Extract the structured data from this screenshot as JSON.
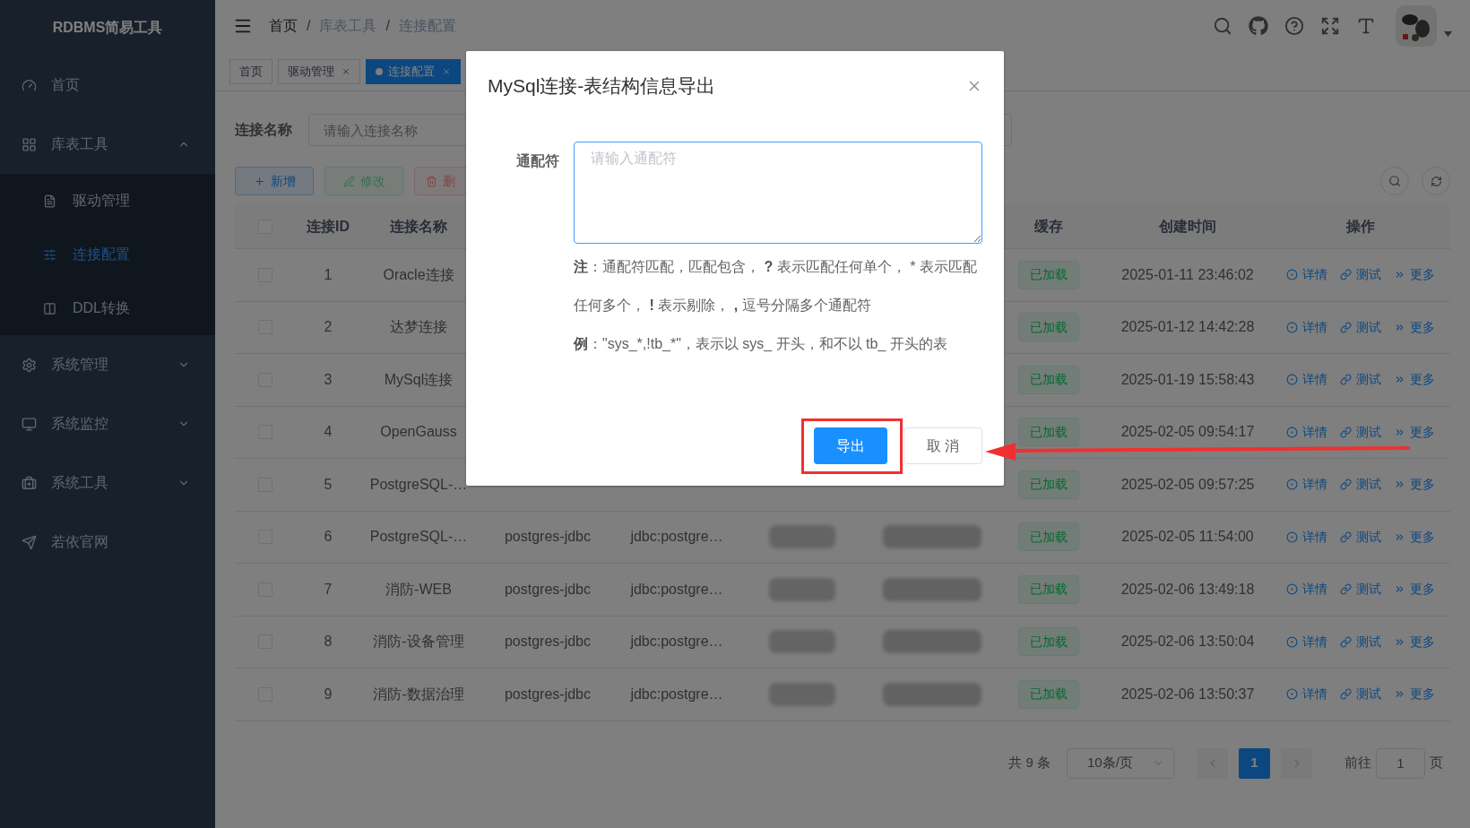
{
  "sidebar": {
    "title": "RDBMS简易工具",
    "items": [
      {
        "label": "首页"
      },
      {
        "label": "库表工具",
        "expanded": true,
        "children": [
          {
            "label": "驱动管理",
            "selected": false
          },
          {
            "label": "连接配置",
            "selected": true
          },
          {
            "label": "DDL转换",
            "selected": false
          }
        ]
      },
      {
        "label": "系统管理",
        "expanded": false
      },
      {
        "label": "系统监控",
        "expanded": false
      },
      {
        "label": "系统工具",
        "expanded": false
      },
      {
        "label": "若依官网"
      }
    ]
  },
  "breadcrumb": [
    "首页",
    "库表工具",
    "连接配置"
  ],
  "breadcrumb_separator": "/",
  "tabs": [
    {
      "label": "首页",
      "closable": false,
      "selected": false
    },
    {
      "label": "驱动管理",
      "closable": true,
      "selected": false
    },
    {
      "label": "连接配置",
      "closable": true,
      "selected": true
    }
  ],
  "search": {
    "label": "连接名称",
    "placeholder": "请输入连接名称"
  },
  "toolbar": [
    {
      "label": "新增",
      "kind": "primary"
    },
    {
      "label": "修改",
      "kind": "success"
    },
    {
      "label": "删",
      "kind": "danger"
    }
  ],
  "table": {
    "select_all_checked": false,
    "columns": {
      "id": "连接ID",
      "name": "连接名称",
      "cache": "缓存",
      "created": "创建时间",
      "actions": "操作"
    },
    "rows": [
      {
        "checked": false,
        "id": "1",
        "name": "Oracle连接",
        "cache": "已加载",
        "created": "2025-01-11 23:46:02",
        "actions": [
          "详情",
          "测试",
          "更多"
        ]
      },
      {
        "checked": false,
        "id": "2",
        "name": "达梦连接",
        "cache": "已加载",
        "created": "2025-01-12 14:42:28",
        "actions": [
          "详情",
          "测试",
          "更多"
        ]
      },
      {
        "checked": false,
        "id": "3",
        "name": "MySql连接",
        "cache": "已加载",
        "created": "2025-01-19 15:58:43",
        "actions": [
          "详情",
          "测试",
          "更多"
        ]
      },
      {
        "checked": false,
        "id": "4",
        "name": "OpenGauss",
        "cache": "已加载",
        "created": "2025-02-05 09:54:17",
        "actions": [
          "详情",
          "测试",
          "更多"
        ]
      },
      {
        "checked": false,
        "id": "5",
        "name": "PostgreSQL-…",
        "cache": "已加载",
        "created": "2025-02-05 09:57:25",
        "actions": [
          "详情",
          "测试",
          "更多"
        ]
      },
      {
        "checked": false,
        "id": "6",
        "name": "PostgreSQL-…",
        "driver": "postgres-jdbc",
        "url": "jdbc:postgre…",
        "cache": "已加载",
        "created": "2025-02-05 11:54:00",
        "actions": [
          "详情",
          "测试",
          "更多"
        ]
      },
      {
        "checked": false,
        "id": "7",
        "name": "消防-WEB",
        "driver": "postgres-jdbc",
        "url": "jdbc:postgre…",
        "cache": "已加载",
        "created": "2025-02-06 13:49:18",
        "actions": [
          "详情",
          "测试",
          "更多"
        ]
      },
      {
        "checked": false,
        "id": "8",
        "name": "消防-设备管理",
        "driver": "postgres-jdbc",
        "url": "jdbc:postgre…",
        "cache": "已加载",
        "created": "2025-02-06 13:50:04",
        "actions": [
          "详情",
          "测试",
          "更多"
        ]
      },
      {
        "checked": false,
        "id": "9",
        "name": "消防-数据治理",
        "driver": "postgres-jdbc",
        "url": "jdbc:postgre…",
        "cache": "已加载",
        "created": "2025-02-06 13:50:37",
        "actions": [
          "详情",
          "测试",
          "更多"
        ]
      }
    ]
  },
  "pagination": {
    "total": "共 9 条",
    "page_size": "10条/页",
    "pages": [
      {
        "label": "1",
        "selected": true
      }
    ],
    "goto_label": "前往",
    "goto_value": "1",
    "goto_suffix": "页"
  },
  "dialog": {
    "title": "MySql连接-表结构信息导出",
    "field_label": "通配符",
    "placeholder": "请输入通配符",
    "notes": [
      [
        {
          "text": "注",
          "bold": true
        },
        {
          "text": "：通配符匹配，匹配包含， "
        },
        {
          "text": "?",
          "bold": true
        },
        {
          "text": " 表示匹配任何单个， * 表示匹配任何多个， "
        },
        {
          "text": "!",
          "bold": true
        },
        {
          "text": " 表示剔除， "
        },
        {
          "text": ",",
          "bold": true
        },
        {
          "text": " 逗号分隔多个通配符"
        }
      ],
      [
        {
          "text": "例",
          "bold": true
        },
        {
          "text": "：\"sys_*,!tb_*\"，表示以 sys_ 开头，和不以 tb_ 开头的表"
        }
      ]
    ],
    "buttons": [
      {
        "label": "导出",
        "kind": "primary"
      },
      {
        "label": "取 消",
        "kind": "default"
      }
    ]
  }
}
